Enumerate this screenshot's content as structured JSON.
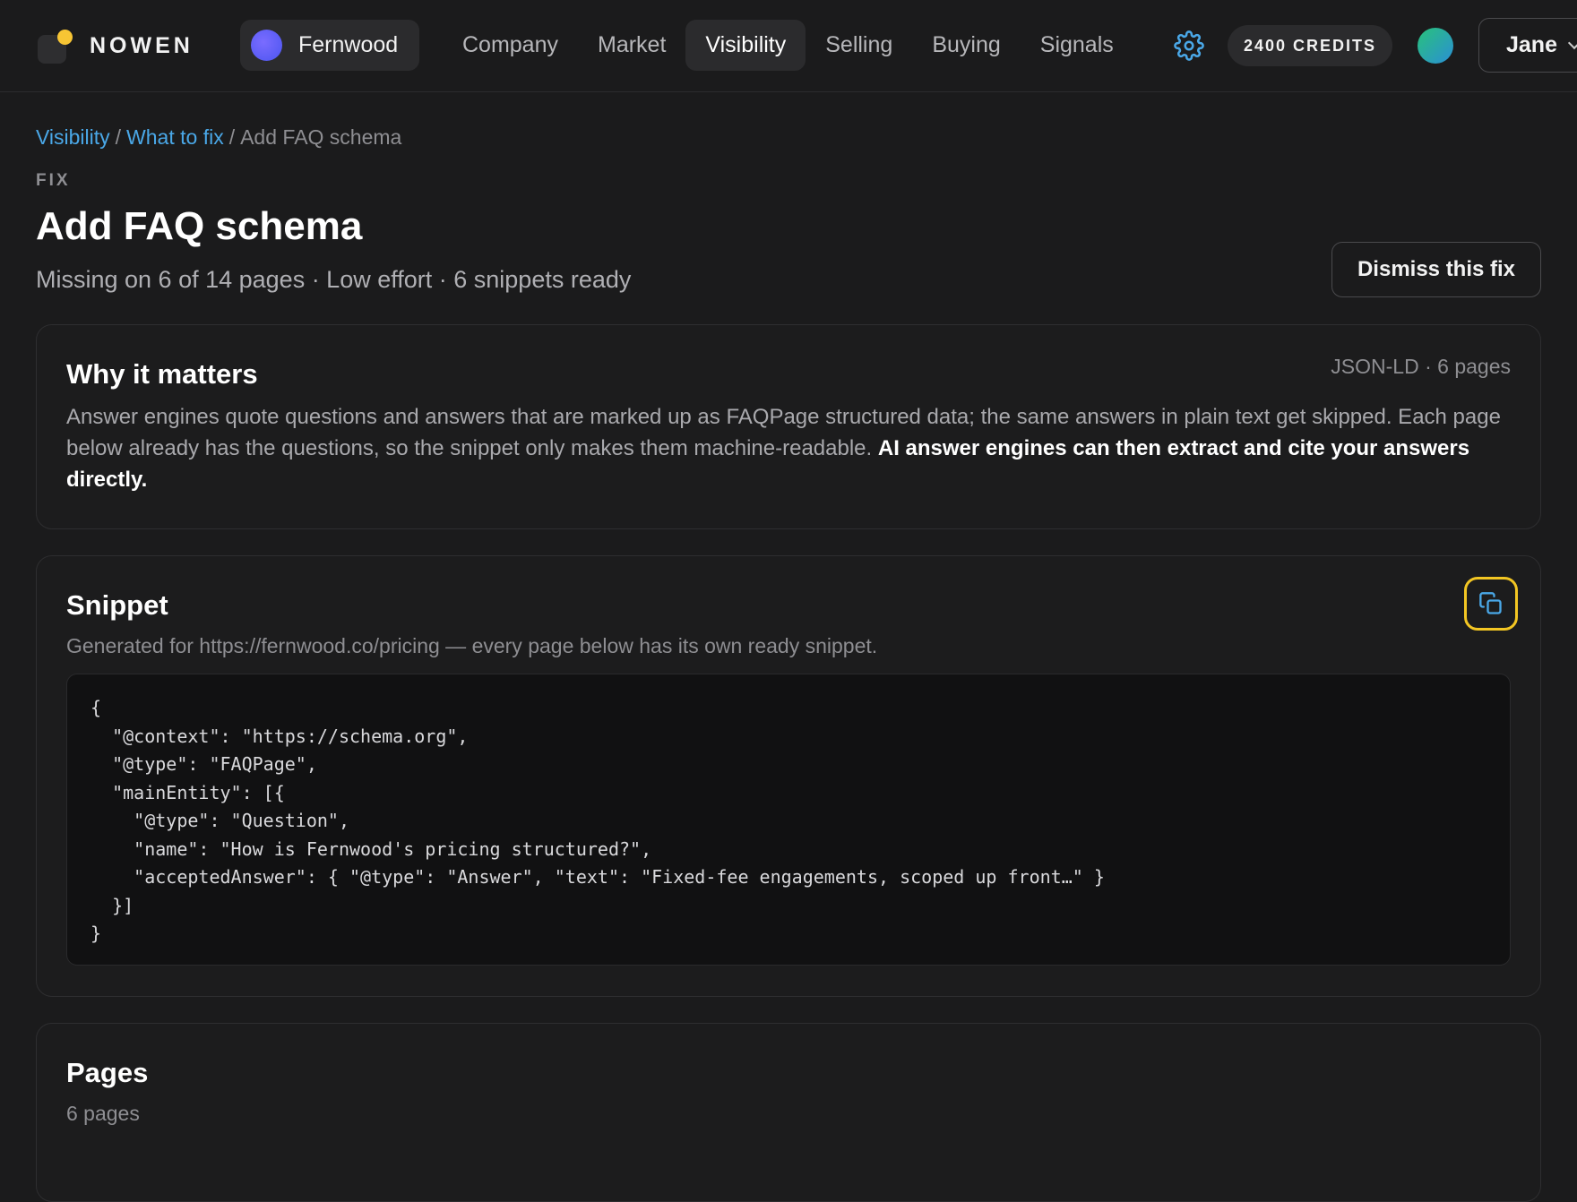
{
  "brand": {
    "name": "NOWEN"
  },
  "workspace": {
    "name": "Fernwood"
  },
  "nav": {
    "items": [
      "Company",
      "Market",
      "Visibility",
      "Selling",
      "Buying",
      "Signals"
    ],
    "active": "Visibility"
  },
  "credits": {
    "label": "2400 CREDITS"
  },
  "user": {
    "name": "Jane"
  },
  "breadcrumb": {
    "items": [
      "Visibility",
      "What to fix"
    ],
    "current": "Add FAQ schema"
  },
  "header": {
    "eyebrow": "FIX",
    "title": "Add FAQ schema",
    "subtitle": "Missing on 6 of 14 pages · Low effort · 6 snippets ready",
    "dismiss_label": "Dismiss this fix"
  },
  "why": {
    "title": "Why it matters",
    "meta": "JSON-LD · 6 pages",
    "body": "Answer engines quote questions and answers that are marked up as FAQPage structured data; the same answers in plain text get skipped. Each page below already has the questions, so the snippet only makes them machine-readable. ",
    "emphasis": "AI answer engines can then extract and cite your answers directly."
  },
  "snippet": {
    "title": "Snippet",
    "description": "Generated for https://fernwood.co/pricing — every page below has its own ready snippet.",
    "code": "{\n  \"@context\": \"https://schema.org\",\n  \"@type\": \"FAQPage\",\n  \"mainEntity\": [{\n    \"@type\": \"Question\",\n    \"name\": \"How is Fernwood's pricing structured?\",\n    \"acceptedAnswer\": { \"@type\": \"Answer\", \"text\": \"Fixed-fee engagements, scoped up front…\" }\n  }]\n}"
  },
  "pages": {
    "title": "Pages",
    "count_label": "6 pages"
  },
  "colors": {
    "accent": "#4aa8e8",
    "copy_focus": "#f3c623",
    "logo_dot": "#f7c534"
  },
  "icons": {
    "settings": "gear-icon",
    "copy": "copy-icon",
    "user_menu": "chevron-down-icon"
  }
}
